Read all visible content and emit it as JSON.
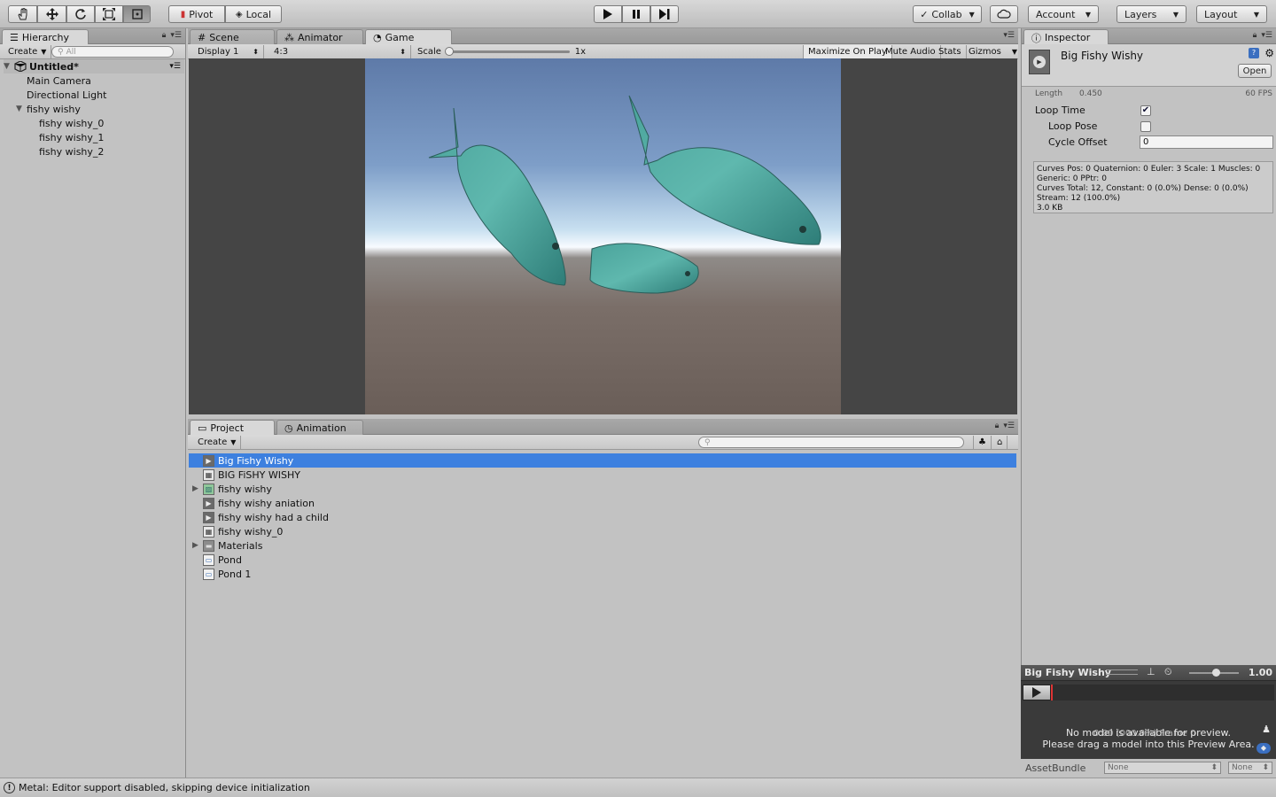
{
  "toolbar": {
    "pivot_label": "Pivot",
    "local_label": "Local",
    "collab_label": "Collab",
    "account_label": "Account",
    "layers_label": "Layers",
    "layout_label": "Layout"
  },
  "hierarchy": {
    "tab_label": "Hierarchy",
    "create_label": "Create",
    "search_placeholder": "All",
    "scene_name": "Untitled*",
    "items": [
      {
        "label": "Main Camera"
      },
      {
        "label": "Directional Light"
      },
      {
        "label": "fishy wishy"
      },
      {
        "label": "fishy wishy_0"
      },
      {
        "label": "fishy wishy_1"
      },
      {
        "label": "fishy wishy_2"
      }
    ]
  },
  "center_tabs": {
    "scene": "Scene",
    "animator": "Animator",
    "game": "Game"
  },
  "game_bar": {
    "display": "Display 1",
    "aspect": "4:3",
    "scale_label": "Scale",
    "scale_value": "1x",
    "maximize": "Maximize On Play",
    "mute": "Mute Audio",
    "stats": "Stats",
    "gizmos": "Gizmos"
  },
  "project": {
    "tab_project": "Project",
    "tab_animation": "Animation",
    "create_label": "Create",
    "items": [
      {
        "label": "Big Fishy Wishy",
        "icon": "animation-clip-icon",
        "selected": true
      },
      {
        "label": "BIG FiSHY WISHY",
        "icon": "sprite-sheet-icon"
      },
      {
        "label": "fishy wishy",
        "icon": "texture-icon",
        "expandable": true
      },
      {
        "label": "fishy wishy aniation",
        "icon": "animation-clip-icon"
      },
      {
        "label": "fishy wishy had a child",
        "icon": "animation-clip-icon"
      },
      {
        "label": "fishy wishy_0",
        "icon": "sprite-sheet-icon"
      },
      {
        "label": "Materials",
        "icon": "folder-icon",
        "expandable": true
      },
      {
        "label": "Pond",
        "icon": "prefab-icon"
      },
      {
        "label": "Pond 1",
        "icon": "prefab-icon"
      }
    ]
  },
  "inspector": {
    "tab_label": "Inspector",
    "asset_name": "Big Fishy Wishy",
    "open_label": "Open",
    "length_label": "Length",
    "length_value": "0.450",
    "fps_label": "60 FPS",
    "loop_time_label": "Loop Time",
    "loop_time_checked": true,
    "loop_pose_label": "Loop Pose",
    "loop_pose_checked": false,
    "cycle_offset_label": "Cycle Offset",
    "cycle_offset_value": "0",
    "info_lines": [
      "Curves Pos: 0 Quaternion: 0 Euler: 3 Scale: 1 Muscles: 0",
      "Generic: 0 PPtr: 0",
      "Curves Total: 12, Constant: 0 (0.0%) Dense: 0 (0.0%)",
      "Stream: 12 (100.0%)",
      "3.0 KB"
    ]
  },
  "preview": {
    "title": "Big Fishy Wishy",
    "speed": "1.00",
    "overlay_text": "0:00 (000.0%) Frame 0",
    "line1": "No model is available for preview.",
    "line2": "Please drag a model into this Preview Area.",
    "assetbundle_label": "AssetBundle",
    "bundle_value": "None",
    "variant_value": "None"
  },
  "status": {
    "message": "Metal: Editor support disabled, skipping device initialization"
  },
  "colors": {
    "selection": "#3d80df",
    "panel_bg": "#c2c2c2",
    "game_bg": "#454545"
  }
}
